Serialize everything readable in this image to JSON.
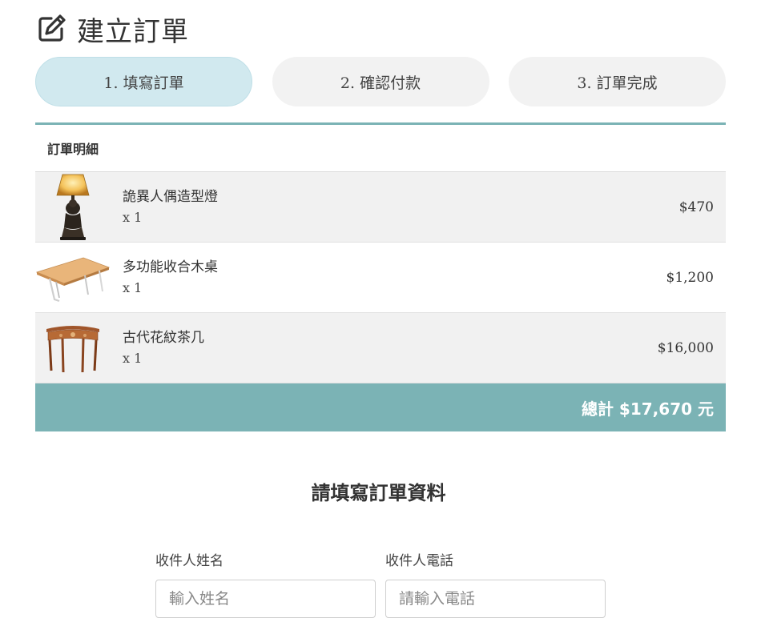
{
  "page": {
    "title": "建立訂單",
    "title_icon": "edit-icon"
  },
  "steps": [
    {
      "label": "1. 填寫訂單",
      "active": true
    },
    {
      "label": "2. 確認付款",
      "active": false
    },
    {
      "label": "3. 訂單完成",
      "active": false
    }
  ],
  "order": {
    "heading": "訂單明細",
    "items": [
      {
        "name": "詭異人偶造型燈",
        "qty": "x 1",
        "price": "$470",
        "image": "lamp-image"
      },
      {
        "name": "多功能收合木桌",
        "qty": "x 1",
        "price": "$1,200",
        "image": "folding-table-image"
      },
      {
        "name": "古代花紋茶几",
        "qty": "x 1",
        "price": "$16,000",
        "image": "console-table-image"
      }
    ],
    "total": "總計 $17,670 元"
  },
  "form": {
    "title": "請填寫訂單資料",
    "name_label": "收件人姓名",
    "name_placeholder": "輸入姓名",
    "name_value": "",
    "phone_label": "收件人電話",
    "phone_placeholder": "請輸入電話",
    "phone_value": ""
  },
  "colors": {
    "accent": "#7bb3b5",
    "active_step": "#d1e9ef",
    "inactive_step": "#f2f2f2"
  }
}
